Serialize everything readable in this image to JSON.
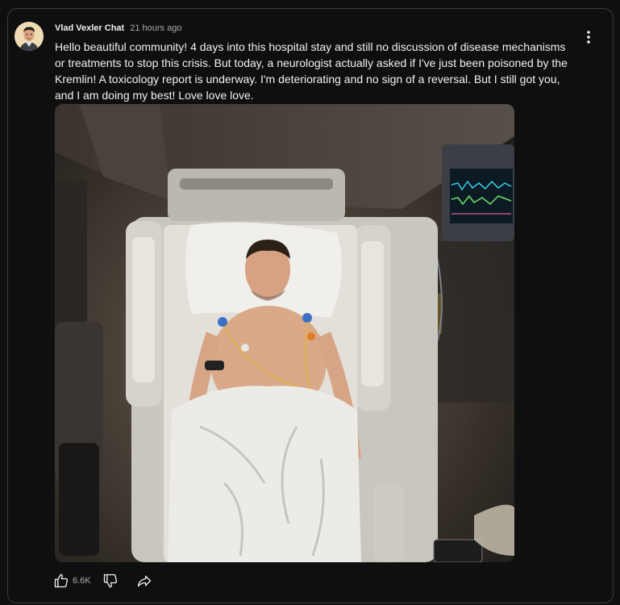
{
  "post": {
    "author": "Vlad Vexler Chat",
    "time": "21 hours ago",
    "text": "Hello beautiful community! 4 days into this hospital stay and still no discussion of disease mechanisms or treatments to stop this crisis. But today, a neurologist actually asked if I've just been poisoned by the Kremlin! A toxicology report is underway. I'm deteriorating and no sign of a reversal. But I still got you, and I am doing my best! Love love love."
  },
  "actions": {
    "like_count": "6.6K"
  },
  "icons": {
    "menu": "more-vertical-icon",
    "like": "thumbs-up-icon",
    "dislike": "thumbs-down-icon",
    "share": "share-icon"
  },
  "colors": {
    "background": "#0f0f0f",
    "border": "#3a3a3a",
    "text_primary": "#f1f1f1",
    "text_secondary": "#aaaaaa"
  }
}
